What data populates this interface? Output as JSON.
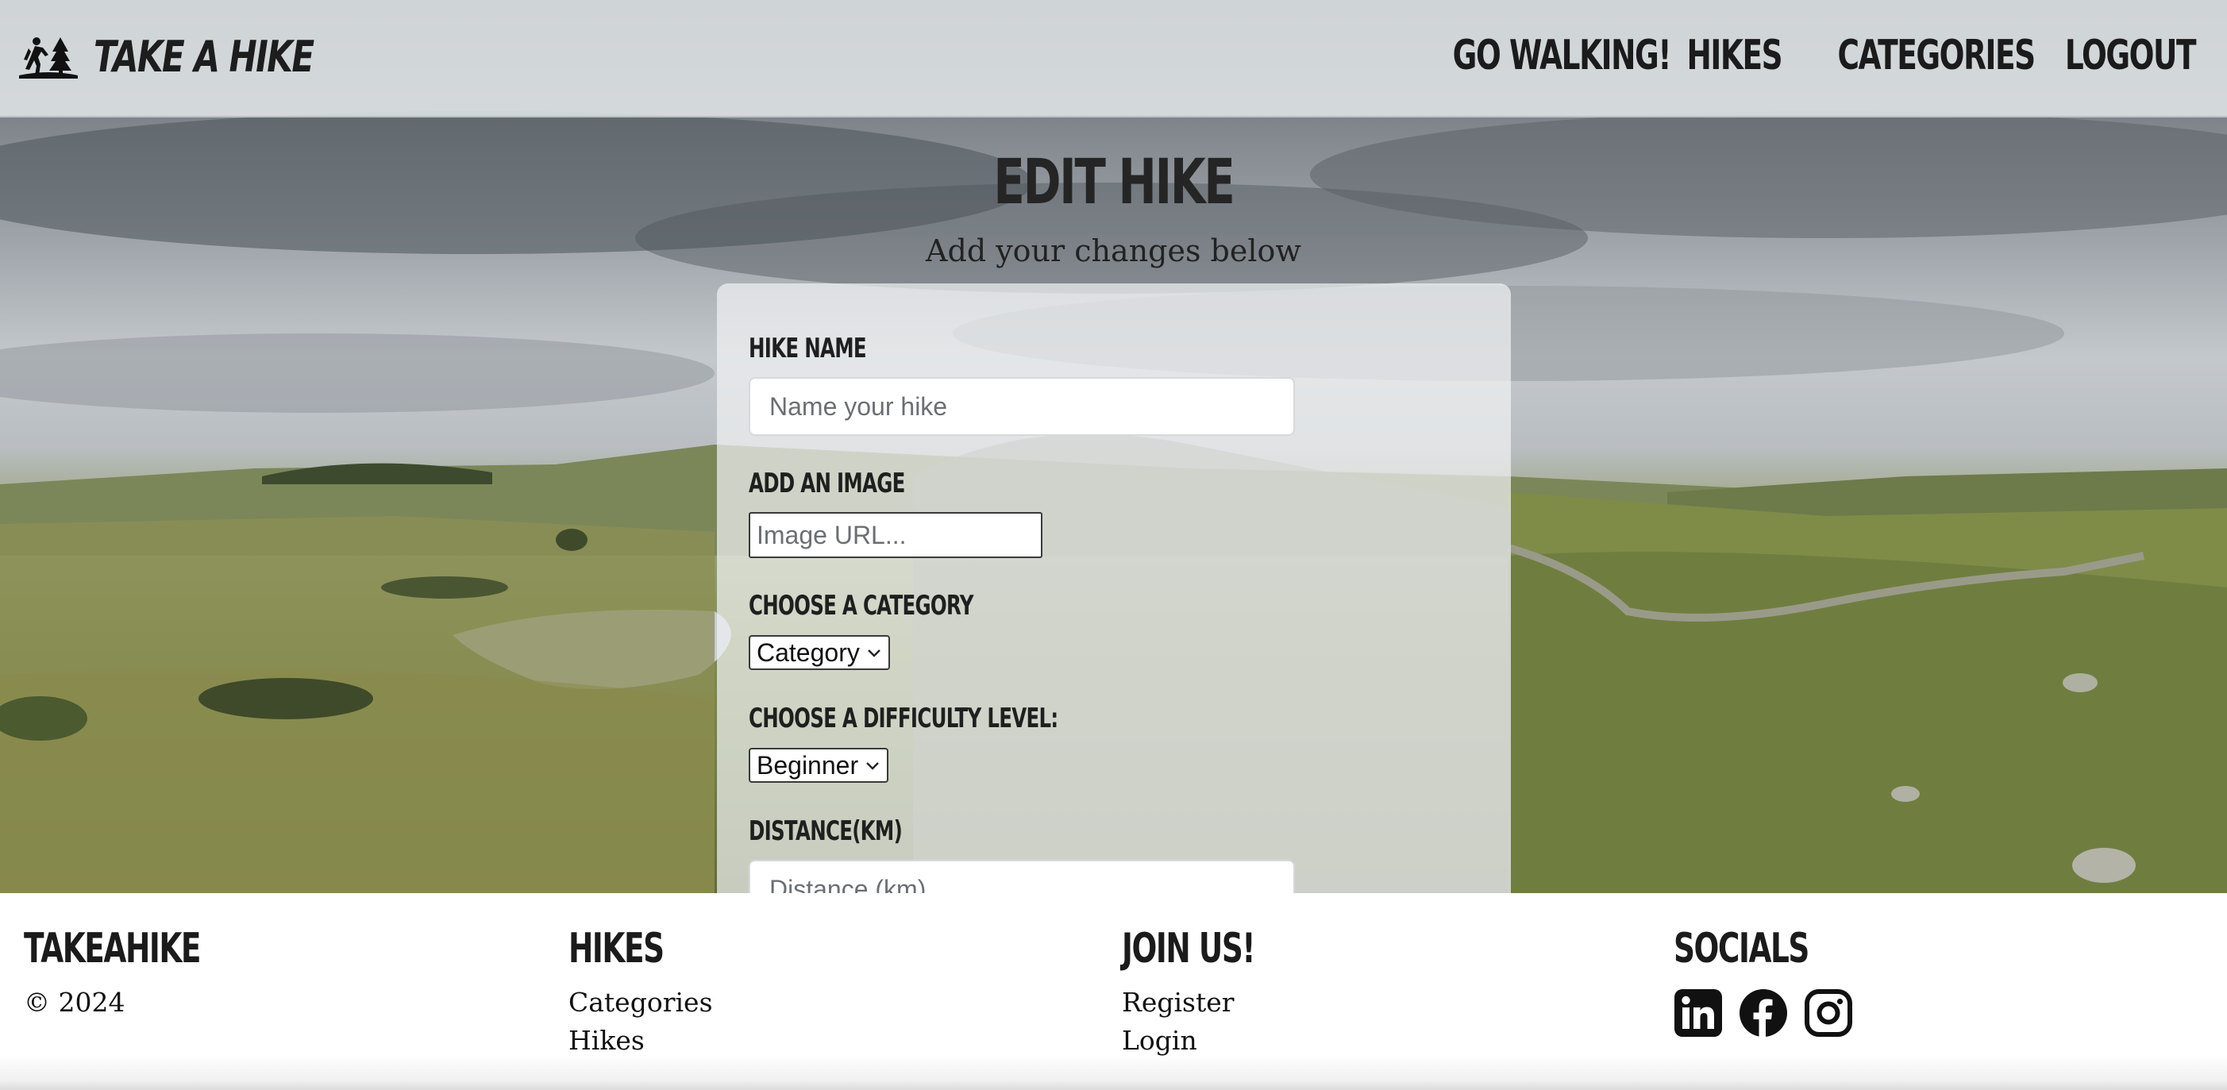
{
  "brand": {
    "name": "TAKE A HIKE"
  },
  "nav": {
    "items": [
      {
        "label": "GO WALKING!"
      },
      {
        "label": "HIKES"
      },
      {
        "label": "CATEGORIES"
      },
      {
        "label": "LOGOUT"
      }
    ]
  },
  "page": {
    "title": "EDIT HIKE",
    "subtitle": "Add your changes below"
  },
  "form": {
    "hike_name": {
      "label": "HIKE NAME",
      "placeholder": "Name your hike",
      "value": ""
    },
    "image": {
      "label": "ADD AN IMAGE",
      "placeholder": "Image URL...",
      "value": ""
    },
    "category": {
      "label": "CHOOSE A CATEGORY",
      "selected": "Category"
    },
    "difficulty": {
      "label": "CHOOSE A DIFFICULTY LEVEL:",
      "selected": "Beginner"
    },
    "distance": {
      "label": "DISTANCE(KM)",
      "placeholder": "Distance (km)",
      "value": ""
    }
  },
  "footer": {
    "brand": {
      "heading": "TAKEAHIKE",
      "copyright": "© 2024"
    },
    "hikes": {
      "heading": "HIKES",
      "links": [
        "Categories",
        "Hikes"
      ]
    },
    "join": {
      "heading": "JOIN US!",
      "links": [
        "Register",
        "Login"
      ]
    },
    "socials": {
      "heading": "SOCIALS",
      "icons": [
        "linkedin-icon",
        "facebook-icon",
        "instagram-icon"
      ]
    }
  },
  "colors": {
    "text_dark": "#1b1b1b",
    "header_bg": "#e2e6e9",
    "card_bg": "#f0f1f2"
  }
}
